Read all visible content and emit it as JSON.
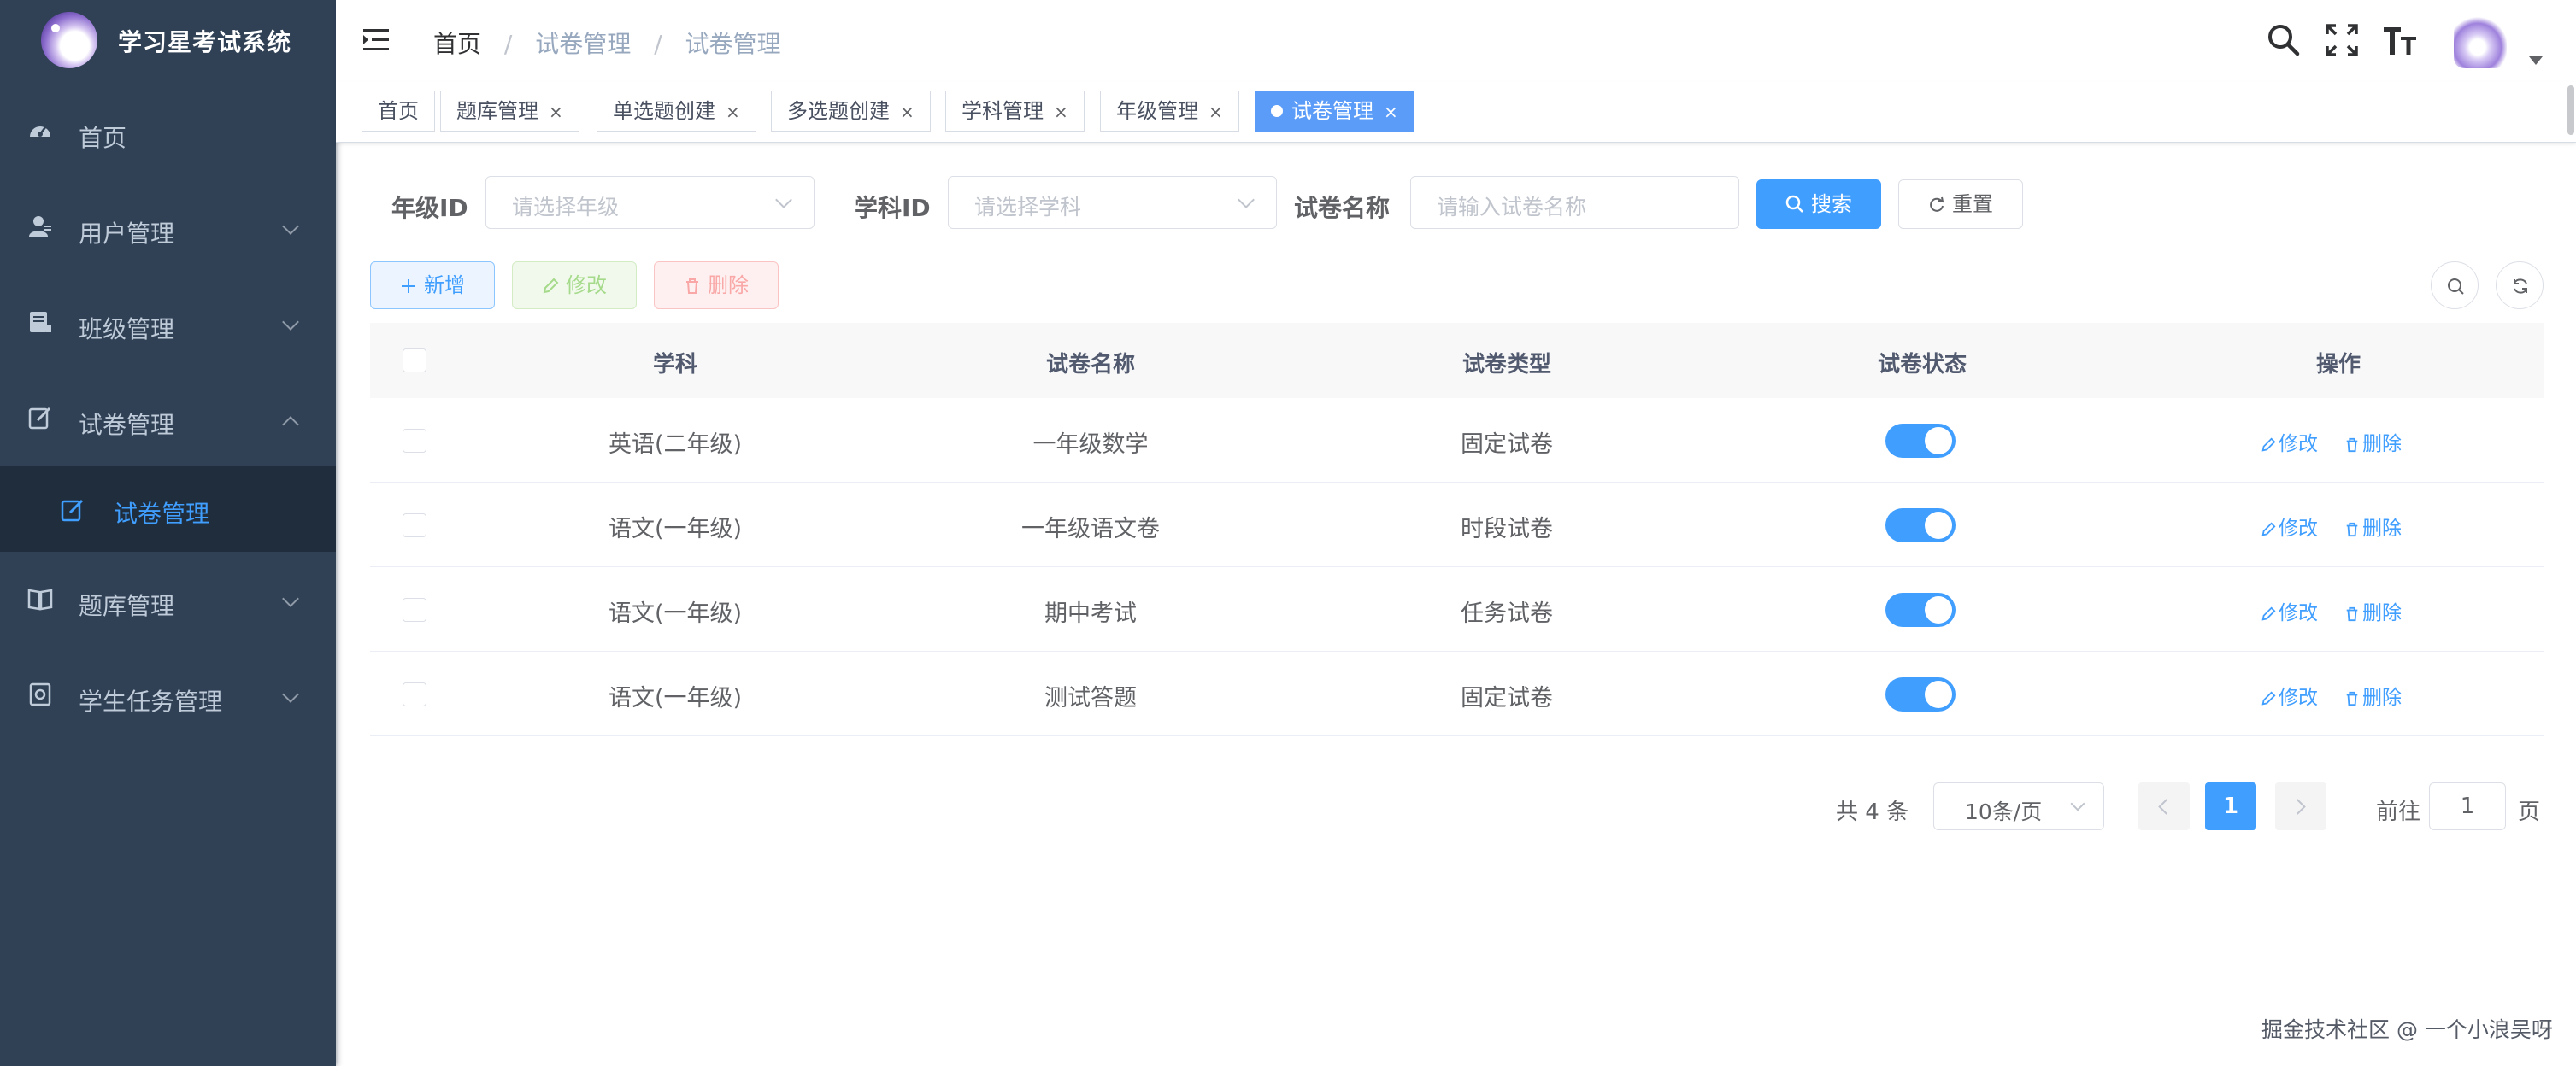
{
  "app": {
    "title": "学习星考试系统"
  },
  "sidebar": {
    "items": [
      {
        "label": "首页",
        "icon": "dashboard-icon"
      },
      {
        "label": "用户管理",
        "icon": "user-icon",
        "expandable": true
      },
      {
        "label": "班级管理",
        "icon": "class-icon",
        "expandable": true
      },
      {
        "label": "试卷管理",
        "icon": "edit-icon",
        "expanded": true,
        "children": [
          {
            "label": "试卷管理",
            "icon": "edit-icon",
            "active": true
          }
        ]
      },
      {
        "label": "题库管理",
        "icon": "book-icon",
        "expandable": true
      },
      {
        "label": "学生任务管理",
        "icon": "task-icon",
        "expandable": true
      }
    ]
  },
  "navbar": {
    "breadcrumb": [
      "首页",
      "试卷管理",
      "试卷管理"
    ],
    "breadcrumb_separator": "/",
    "icons": [
      "search-icon",
      "fullscreen-icon",
      "font-size-icon",
      "avatar"
    ]
  },
  "tags": [
    {
      "label": "首页",
      "closable": false
    },
    {
      "label": "题库管理",
      "closable": true
    },
    {
      "label": "单选题创建",
      "closable": true
    },
    {
      "label": "多选题创建",
      "closable": true
    },
    {
      "label": "学科管理",
      "closable": true
    },
    {
      "label": "年级管理",
      "closable": true
    },
    {
      "label": "试卷管理",
      "closable": true,
      "active": true
    }
  ],
  "tag_close_glyph": "×",
  "search": {
    "grade_label": "年级ID",
    "grade_placeholder": "请选择年级",
    "subject_label": "学科ID",
    "subject_placeholder": "请选择学科",
    "name_label": "试卷名称",
    "name_placeholder": "请输入试卷名称",
    "search_button": "搜索",
    "reset_button": "重置"
  },
  "toolbar": {
    "add_button": "新增",
    "edit_button": "修改",
    "delete_button": "删除"
  },
  "table": {
    "columns": [
      "学科",
      "试卷名称",
      "试卷类型",
      "试卷状态",
      "操作"
    ],
    "rows": [
      {
        "subject": "英语(二年级)",
        "name": "一年级数学",
        "type": "固定试卷",
        "status": true
      },
      {
        "subject": "语文(一年级)",
        "name": "一年级语文卷",
        "type": "时段试卷",
        "status": true
      },
      {
        "subject": "语文(一年级)",
        "name": "期中考试",
        "type": "任务试卷",
        "status": true
      },
      {
        "subject": "语文(一年级)",
        "name": "测试答题",
        "type": "固定试卷",
        "status": true
      }
    ],
    "row_edit_label": "修改",
    "row_delete_label": "删除"
  },
  "pagination": {
    "total_text": "共 4 条",
    "page_size": "10条/页",
    "current_page": "1",
    "goto_label": "前往",
    "goto_value": "1",
    "page_suffix": "页"
  },
  "watermark": "掘金技术社区 @ 一个小浪吴呀",
  "colors": {
    "sidebar_bg": "#304156",
    "submenu_active_bg": "#1f2d3d",
    "accent": "#409eff",
    "active_tag": "#5a9cf8"
  }
}
